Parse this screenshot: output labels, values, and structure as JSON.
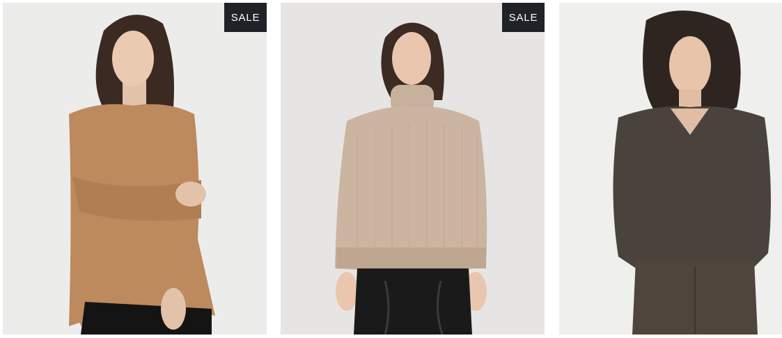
{
  "products": [
    {
      "image": "woman-in-camel-oversized-sweater",
      "badge": "SALE",
      "colors": {
        "sweater": "#bd8a5d",
        "background": "#ececeb"
      }
    },
    {
      "image": "woman-in-beige-chunky-knit-turtleneck",
      "badge": "SALE",
      "colors": {
        "sweater": "#cbb5a0",
        "background": "#e6e5e4"
      }
    },
    {
      "image": "woman-in-dark-brown-v-neck-sweater",
      "badge": "",
      "colors": {
        "sweater": "#4a433d",
        "background": "#efefee"
      }
    }
  ]
}
